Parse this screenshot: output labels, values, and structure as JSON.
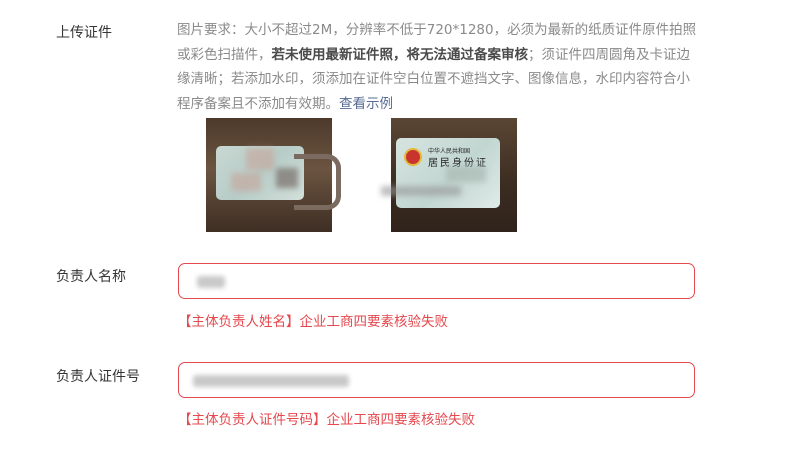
{
  "upload": {
    "label": "上传证件",
    "requirements_1": "图片要求：大小不超过2M，分辨率不低于720*1280，必须为最新的纸质证件原件拍照或彩色扫描件，",
    "requirements_bold": "若未使用最新证件照，将无法通过备案审核",
    "requirements_2": "；须证件四周圆角及卡证边缘清晰；若添加水印，须添加在证件空白位置不遮挡文字、图像信息，水印内容符合小程序备案且不添加有效期。",
    "example_link": "查看示例",
    "id_card": {
      "header": "中华人民共和国",
      "title": "居民身份证"
    }
  },
  "name_field": {
    "label": "负责人名称",
    "error": "【主体负责人姓名】企业工商四要素核验失败"
  },
  "id_field": {
    "label": "负责人证件号",
    "error": "【主体负责人证件号码】企业工商四要素核验失败"
  }
}
